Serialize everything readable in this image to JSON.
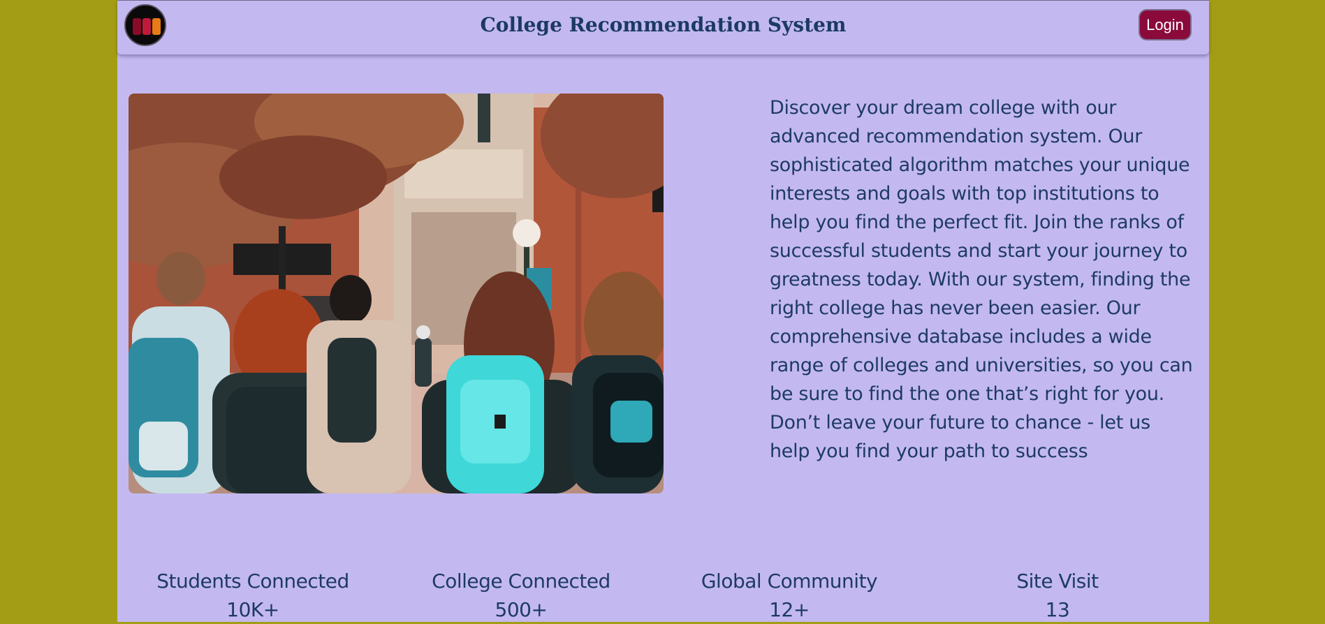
{
  "colors": {
    "outer_background": "#a29d14",
    "page_background": "#c3b9f0",
    "text": "#1e3a64",
    "login_button": "#8a0a3c"
  },
  "header": {
    "logo_icon": "three-bars-logo",
    "title": "College Recommendation System",
    "login_label": "Login"
  },
  "hero": {
    "image_icon": "students-walking-photo",
    "description": "Discover your dream college with our advanced recommendation system. Our sophisticated algorithm matches your unique interests and goals with top institutions to help you find the perfect fit. Join the ranks of successful students and start your journey to greatness today. With our system, finding the right college has never been easier. Our comprehensive database includes a wide range of colleges and universities, so you can be sure to find the one that’s right for you. Don’t leave your future to chance - let us help you find your path to success"
  },
  "stats": [
    {
      "label": "Students Connected",
      "value": "10K+"
    },
    {
      "label": "College Connected",
      "value": "500+"
    },
    {
      "label": "Global Community",
      "value": "12+"
    },
    {
      "label": "Site Visit",
      "value": "13"
    }
  ]
}
